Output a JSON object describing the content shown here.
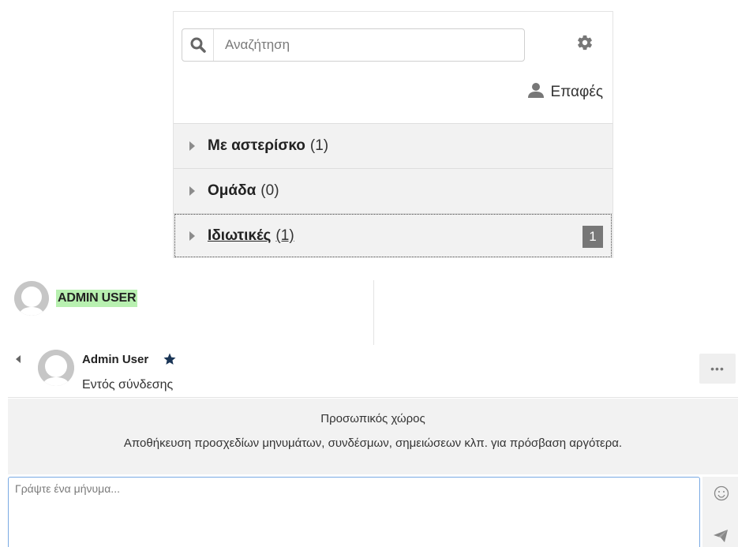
{
  "search": {
    "placeholder": "Αναζήτηση",
    "value": ""
  },
  "icons": {
    "search": "search-icon",
    "settings": "gear-icon",
    "contacts": "user-icon",
    "more": "ellipsis-icon",
    "emoji": "smiley-icon",
    "send": "send-icon",
    "favourite": "star-icon"
  },
  "contacts_link": {
    "label": "Επαφές"
  },
  "sections": [
    {
      "name": "Με αστερίσκο",
      "count": "(1)"
    },
    {
      "name": "Ομάδα",
      "count": "(0)"
    },
    {
      "name": "Ιδιωτικές",
      "count": "(1)",
      "badge": "1"
    }
  ],
  "top_user": {
    "name": "ADMIN USER"
  },
  "conversation": {
    "name": "Admin User",
    "status": "Εντός σύνδεσης",
    "more_label": "•••"
  },
  "info": {
    "title": "Προσωπικός χώρος",
    "description": "Αποθήκευση προσχεδίων μηνυμάτων, συνδέσμων, σημειώσεων κλπ. για πρόσβαση αργότερα."
  },
  "composer": {
    "placeholder": "Γράψτε ένα μήνυμα...",
    "value": ""
  },
  "colors": {
    "highlight": "#b8f0b0",
    "star": "#1a3556",
    "focus_border": "#79a9e3",
    "badge": "#777777"
  }
}
